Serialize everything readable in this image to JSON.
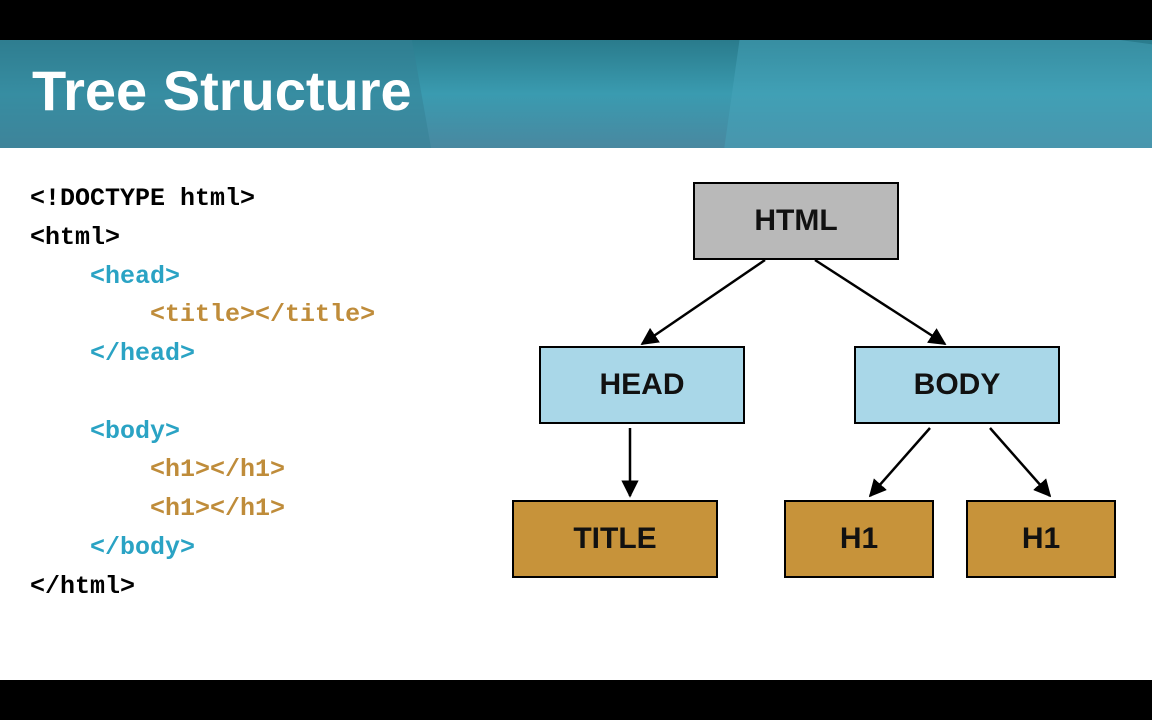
{
  "title": "Tree Structure",
  "code": {
    "l1": "<!DOCTYPE html>",
    "l2": "<html>",
    "l3": "<head>",
    "l4": "<title></title>",
    "l5": "</head>",
    "l6": "<body>",
    "l7": "<h1></h1>",
    "l8": "<h1></h1>",
    "l9": "</body>",
    "l10": "</html>"
  },
  "nodes": {
    "html": "HTML",
    "head": "HEAD",
    "body": "BODY",
    "title": "TITLE",
    "h1a": "H1",
    "h1b": "H1"
  }
}
